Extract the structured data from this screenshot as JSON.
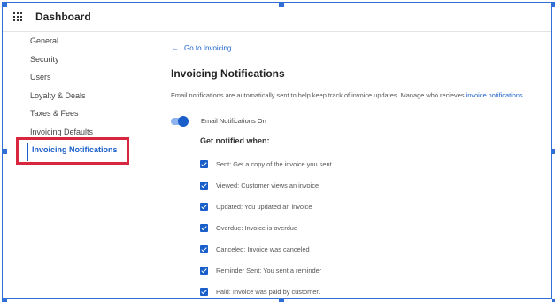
{
  "header": {
    "title": "Dashboard",
    "menu_icon": "grid-menu-icon"
  },
  "sidebar": {
    "items": [
      {
        "label": "General"
      },
      {
        "label": "Security"
      },
      {
        "label": "Users"
      },
      {
        "label": "Loyalty & Deals"
      },
      {
        "label": "Taxes & Fees"
      },
      {
        "label": "Invoicing Defaults"
      },
      {
        "label": "Invoicing Notifications",
        "active": true
      }
    ]
  },
  "main": {
    "back_link": "Go to Invoicing",
    "title": "Invoicing Notifications",
    "description": "Email notifications are automatically sent to help keep track of invoice updates. Manage who recieves ",
    "description_link": "invoice notifications",
    "toggle": {
      "label": "Email Notifications On",
      "on": true
    },
    "notified_title": "Get notified when:",
    "options": [
      {
        "label": "Sent: Get a copy of the invoice you sent",
        "checked": true
      },
      {
        "label": "Viewed: Customer views an invoice",
        "checked": true
      },
      {
        "label": "Updated: You updated an invoice",
        "checked": true
      },
      {
        "label": "Overdue: Invoice is overdue",
        "checked": true
      },
      {
        "label": "Canceled: Invoice was canceled",
        "checked": true
      },
      {
        "label": "Reminder Sent: You sent a reminder",
        "checked": true
      },
      {
        "label": "Paid: Invoice was paid by customer.",
        "checked": true
      }
    ]
  },
  "colors": {
    "accent": "#1a5fc9",
    "highlight": "#d7263d",
    "selection": "#2f6fd6"
  }
}
